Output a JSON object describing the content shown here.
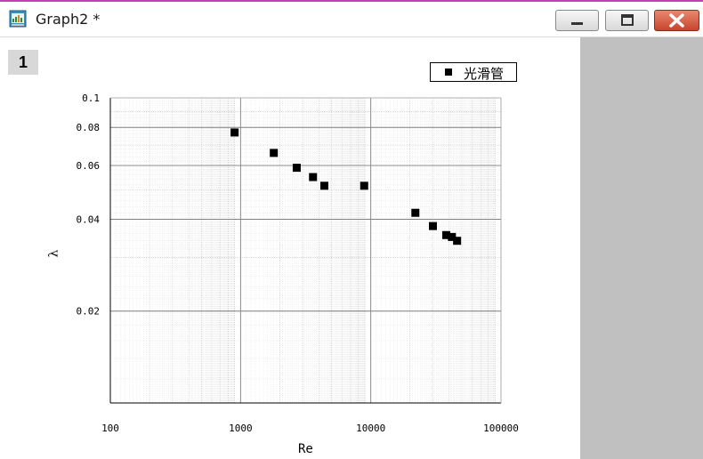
{
  "window": {
    "title": "Graph2 *",
    "layer_tab": "1",
    "accent_color": "#c23fb8",
    "close_color": "#c8442d",
    "icons": [
      "graph-app-icon",
      "minimize-icon",
      "maximize-icon",
      "close-icon"
    ]
  },
  "chart_data": {
    "type": "scatter",
    "xlabel": "Re",
    "ylabel": "λ",
    "xscale": "log",
    "yscale": "log",
    "xlim": [
      100,
      100000
    ],
    "ylim": [
      0.01,
      0.1
    ],
    "x_ticks": [
      "100",
      "1000",
      "10000",
      "100000"
    ],
    "y_ticks": [
      "0.1",
      "0.08",
      "0.06",
      "0.04",
      "0.02"
    ],
    "grid": true,
    "legend_position": "top-right",
    "series": [
      {
        "name": "光滑管",
        "marker": "square",
        "color": "#000000",
        "x": [
          900,
          1800,
          2700,
          3600,
          4400,
          8900,
          22000,
          30000,
          38000,
          42000,
          46000
        ],
        "y": [
          0.077,
          0.066,
          0.059,
          0.055,
          0.0515,
          0.0515,
          0.042,
          0.038,
          0.0355,
          0.035,
          0.034
        ]
      }
    ]
  }
}
